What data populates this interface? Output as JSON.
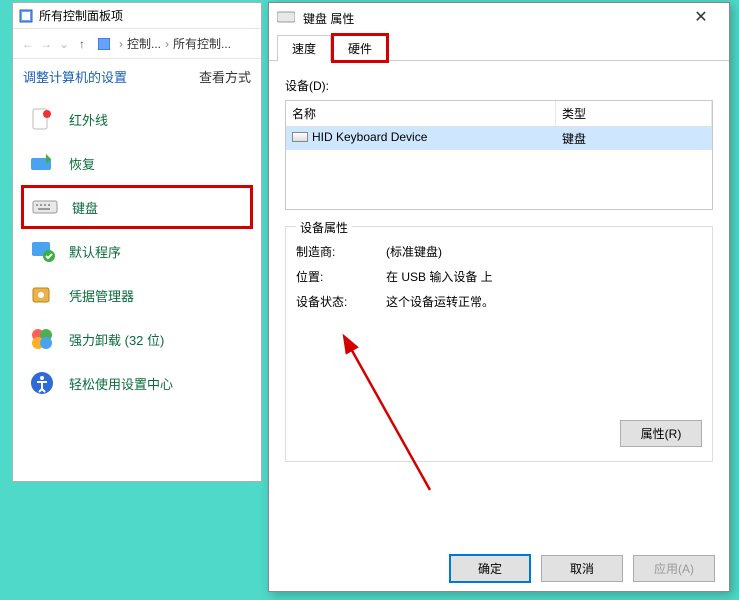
{
  "explorer": {
    "title": "所有控制面板项",
    "breadcrumb": {
      "seg1": "控制...",
      "seg2": "所有控制..."
    },
    "heading": "调整计算机的设置",
    "viewmode": "查看方式",
    "items": [
      {
        "label": "红外线"
      },
      {
        "label": "恢复"
      },
      {
        "label": "键盘"
      },
      {
        "label": "默认程序"
      },
      {
        "label": "凭据管理器"
      },
      {
        "label": "强力卸载 (32 位)"
      },
      {
        "label": "轻松使用设置中心"
      }
    ]
  },
  "dialog": {
    "title": "键盘 属性",
    "tabs": {
      "speed": "速度",
      "hardware": "硬件"
    },
    "devices_label": "设备(D):",
    "columns": {
      "name": "名称",
      "type": "类型"
    },
    "device_row": {
      "name": "HID Keyboard Device",
      "type": "键盘"
    },
    "props_legend": "设备属性",
    "props": {
      "manufacturer_label": "制造商:",
      "manufacturer_value": "(标准键盘)",
      "location_label": "位置:",
      "location_value": "在 USB 输入设备 上",
      "status_label": "设备状态:",
      "status_value": "这个设备运转正常。"
    },
    "properties_btn": "属性(R)",
    "ok_btn": "确定",
    "cancel_btn": "取消",
    "apply_btn": "应用(A)"
  }
}
